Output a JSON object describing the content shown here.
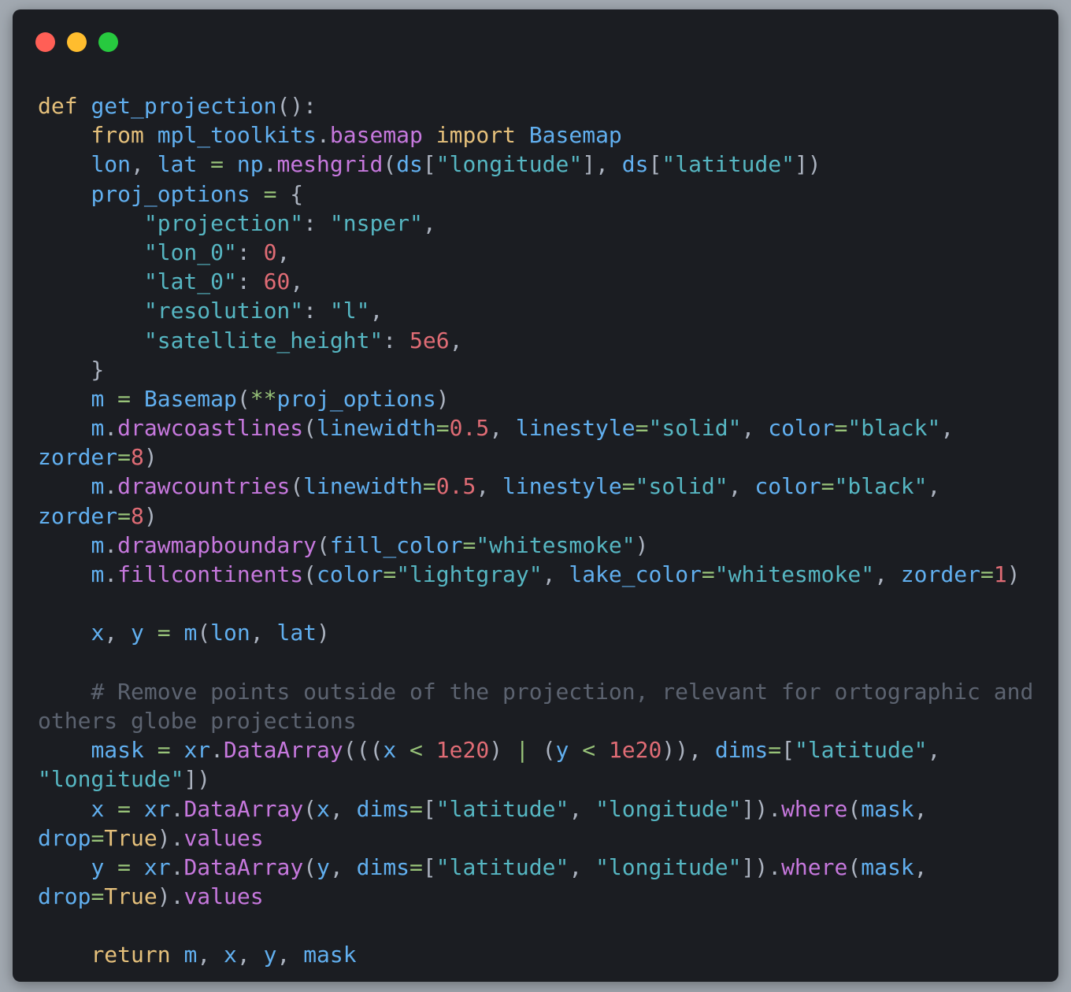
{
  "window": {
    "controls": [
      {
        "name": "close",
        "color": "#ff5f56"
      },
      {
        "name": "minimize",
        "color": "#ffbd2e"
      },
      {
        "name": "zoom",
        "color": "#27c93f"
      }
    ],
    "background": "#1b1d22"
  },
  "theme": {
    "keyword": "#e5c07b",
    "identifier": "#61afef",
    "function": "#c678dd",
    "string": "#56b6c2",
    "number": "#e06c75",
    "operator": "#98c379",
    "punctuation": "#abb2bf",
    "comment": "#5c6370"
  },
  "code": {
    "lines": [
      [
        [
          "kw",
          "def"
        ],
        [
          "pl",
          " "
        ],
        [
          "id",
          "get_projection"
        ],
        [
          "pl",
          "():"
        ]
      ],
      [
        [
          "pl",
          "    "
        ],
        [
          "kw",
          "from"
        ],
        [
          "pl",
          " "
        ],
        [
          "id",
          "mpl_toolkits"
        ],
        [
          "pl",
          "."
        ],
        [
          "fn",
          "basemap"
        ],
        [
          "pl",
          " "
        ],
        [
          "kw",
          "import"
        ],
        [
          "pl",
          " "
        ],
        [
          "id",
          "Basemap"
        ]
      ],
      [
        [
          "pl",
          "    "
        ],
        [
          "id",
          "lon"
        ],
        [
          "pl",
          ", "
        ],
        [
          "id",
          "lat"
        ],
        [
          "pl",
          " "
        ],
        [
          "op",
          "="
        ],
        [
          "pl",
          " "
        ],
        [
          "id",
          "np"
        ],
        [
          "pl",
          "."
        ],
        [
          "fn",
          "meshgrid"
        ],
        [
          "pl",
          "("
        ],
        [
          "id",
          "ds"
        ],
        [
          "pl",
          "["
        ],
        [
          "str",
          "\"longitude\""
        ],
        [
          "pl",
          "], "
        ],
        [
          "id",
          "ds"
        ],
        [
          "pl",
          "["
        ],
        [
          "str",
          "\"latitude\""
        ],
        [
          "pl",
          "])"
        ]
      ],
      [
        [
          "pl",
          "    "
        ],
        [
          "id",
          "proj_options"
        ],
        [
          "pl",
          " "
        ],
        [
          "op",
          "="
        ],
        [
          "pl",
          " {"
        ]
      ],
      [
        [
          "pl",
          "        "
        ],
        [
          "str",
          "\"projection\""
        ],
        [
          "pl",
          ": "
        ],
        [
          "str",
          "\"nsper\""
        ],
        [
          "pl",
          ","
        ]
      ],
      [
        [
          "pl",
          "        "
        ],
        [
          "str",
          "\"lon_0\""
        ],
        [
          "pl",
          ": "
        ],
        [
          "num",
          "0"
        ],
        [
          "pl",
          ","
        ]
      ],
      [
        [
          "pl",
          "        "
        ],
        [
          "str",
          "\"lat_0\""
        ],
        [
          "pl",
          ": "
        ],
        [
          "num",
          "60"
        ],
        [
          "pl",
          ","
        ]
      ],
      [
        [
          "pl",
          "        "
        ],
        [
          "str",
          "\"resolution\""
        ],
        [
          "pl",
          ": "
        ],
        [
          "str",
          "\"l\""
        ],
        [
          "pl",
          ","
        ]
      ],
      [
        [
          "pl",
          "        "
        ],
        [
          "str",
          "\"satellite_height\""
        ],
        [
          "pl",
          ": "
        ],
        [
          "num",
          "5e6"
        ],
        [
          "pl",
          ","
        ]
      ],
      [
        [
          "pl",
          "    }"
        ]
      ],
      [
        [
          "pl",
          "    "
        ],
        [
          "id",
          "m"
        ],
        [
          "pl",
          " "
        ],
        [
          "op",
          "="
        ],
        [
          "pl",
          " "
        ],
        [
          "id",
          "Basemap"
        ],
        [
          "pl",
          "("
        ],
        [
          "op",
          "**"
        ],
        [
          "id",
          "proj_options"
        ],
        [
          "pl",
          ")"
        ]
      ],
      [
        [
          "pl",
          "    "
        ],
        [
          "id",
          "m"
        ],
        [
          "pl",
          "."
        ],
        [
          "fn",
          "drawcoastlines"
        ],
        [
          "pl",
          "("
        ],
        [
          "id",
          "linewidth"
        ],
        [
          "op",
          "="
        ],
        [
          "num",
          "0.5"
        ],
        [
          "pl",
          ", "
        ],
        [
          "id",
          "linestyle"
        ],
        [
          "op",
          "="
        ],
        [
          "str",
          "\"solid\""
        ],
        [
          "pl",
          ", "
        ],
        [
          "id",
          "color"
        ],
        [
          "op",
          "="
        ],
        [
          "str",
          "\"black\""
        ],
        [
          "pl",
          ","
        ]
      ],
      [
        [
          "id",
          "zorder"
        ],
        [
          "op",
          "="
        ],
        [
          "num",
          "8"
        ],
        [
          "pl",
          ")"
        ]
      ],
      [
        [
          "pl",
          "    "
        ],
        [
          "id",
          "m"
        ],
        [
          "pl",
          "."
        ],
        [
          "fn",
          "drawcountries"
        ],
        [
          "pl",
          "("
        ],
        [
          "id",
          "linewidth"
        ],
        [
          "op",
          "="
        ],
        [
          "num",
          "0.5"
        ],
        [
          "pl",
          ", "
        ],
        [
          "id",
          "linestyle"
        ],
        [
          "op",
          "="
        ],
        [
          "str",
          "\"solid\""
        ],
        [
          "pl",
          ", "
        ],
        [
          "id",
          "color"
        ],
        [
          "op",
          "="
        ],
        [
          "str",
          "\"black\""
        ],
        [
          "pl",
          ","
        ]
      ],
      [
        [
          "id",
          "zorder"
        ],
        [
          "op",
          "="
        ],
        [
          "num",
          "8"
        ],
        [
          "pl",
          ")"
        ]
      ],
      [
        [
          "pl",
          "    "
        ],
        [
          "id",
          "m"
        ],
        [
          "pl",
          "."
        ],
        [
          "fn",
          "drawmapboundary"
        ],
        [
          "pl",
          "("
        ],
        [
          "id",
          "fill_color"
        ],
        [
          "op",
          "="
        ],
        [
          "str",
          "\"whitesmoke\""
        ],
        [
          "pl",
          ")"
        ]
      ],
      [
        [
          "pl",
          "    "
        ],
        [
          "id",
          "m"
        ],
        [
          "pl",
          "."
        ],
        [
          "fn",
          "fillcontinents"
        ],
        [
          "pl",
          "("
        ],
        [
          "id",
          "color"
        ],
        [
          "op",
          "="
        ],
        [
          "str",
          "\"lightgray\""
        ],
        [
          "pl",
          ", "
        ],
        [
          "id",
          "lake_color"
        ],
        [
          "op",
          "="
        ],
        [
          "str",
          "\"whitesmoke\""
        ],
        [
          "pl",
          ", "
        ],
        [
          "id",
          "zorder"
        ],
        [
          "op",
          "="
        ],
        [
          "num",
          "1"
        ],
        [
          "pl",
          ")"
        ]
      ],
      [],
      [
        [
          "pl",
          "    "
        ],
        [
          "id",
          "x"
        ],
        [
          "pl",
          ", "
        ],
        [
          "id",
          "y"
        ],
        [
          "pl",
          " "
        ],
        [
          "op",
          "="
        ],
        [
          "pl",
          " "
        ],
        [
          "id",
          "m"
        ],
        [
          "pl",
          "("
        ],
        [
          "id",
          "lon"
        ],
        [
          "pl",
          ", "
        ],
        [
          "id",
          "lat"
        ],
        [
          "pl",
          ")"
        ]
      ],
      [],
      [
        [
          "pl",
          "    "
        ],
        [
          "cm",
          "# Remove points outside of the projection, relevant for ortographic and"
        ]
      ],
      [
        [
          "cm",
          "others globe projections"
        ]
      ],
      [
        [
          "pl",
          "    "
        ],
        [
          "id",
          "mask"
        ],
        [
          "pl",
          " "
        ],
        [
          "op",
          "="
        ],
        [
          "pl",
          " "
        ],
        [
          "id",
          "xr"
        ],
        [
          "pl",
          "."
        ],
        [
          "fn",
          "DataArray"
        ],
        [
          "pl",
          "((("
        ],
        [
          "id",
          "x"
        ],
        [
          "pl",
          " "
        ],
        [
          "op",
          "<"
        ],
        [
          "pl",
          " "
        ],
        [
          "num",
          "1e20"
        ],
        [
          "pl",
          ") "
        ],
        [
          "op",
          "|"
        ],
        [
          "pl",
          " ("
        ],
        [
          "id",
          "y"
        ],
        [
          "pl",
          " "
        ],
        [
          "op",
          "<"
        ],
        [
          "pl",
          " "
        ],
        [
          "num",
          "1e20"
        ],
        [
          "pl",
          ")), "
        ],
        [
          "id",
          "dims"
        ],
        [
          "op",
          "="
        ],
        [
          "pl",
          "["
        ],
        [
          "str",
          "\"latitude\""
        ],
        [
          "pl",
          ","
        ]
      ],
      [
        [
          "str",
          "\"longitude\""
        ],
        [
          "pl",
          "])"
        ]
      ],
      [
        [
          "pl",
          "    "
        ],
        [
          "id",
          "x"
        ],
        [
          "pl",
          " "
        ],
        [
          "op",
          "="
        ],
        [
          "pl",
          " "
        ],
        [
          "id",
          "xr"
        ],
        [
          "pl",
          "."
        ],
        [
          "fn",
          "DataArray"
        ],
        [
          "pl",
          "("
        ],
        [
          "id",
          "x"
        ],
        [
          "pl",
          ", "
        ],
        [
          "id",
          "dims"
        ],
        [
          "op",
          "="
        ],
        [
          "pl",
          "["
        ],
        [
          "str",
          "\"latitude\""
        ],
        [
          "pl",
          ", "
        ],
        [
          "str",
          "\"longitude\""
        ],
        [
          "pl",
          "])."
        ],
        [
          "fn",
          "where"
        ],
        [
          "pl",
          "("
        ],
        [
          "id",
          "mask"
        ],
        [
          "pl",
          ","
        ]
      ],
      [
        [
          "id",
          "drop"
        ],
        [
          "op",
          "="
        ],
        [
          "kw",
          "True"
        ],
        [
          "pl",
          ")."
        ],
        [
          "fn",
          "values"
        ]
      ],
      [
        [
          "pl",
          "    "
        ],
        [
          "id",
          "y"
        ],
        [
          "pl",
          " "
        ],
        [
          "op",
          "="
        ],
        [
          "pl",
          " "
        ],
        [
          "id",
          "xr"
        ],
        [
          "pl",
          "."
        ],
        [
          "fn",
          "DataArray"
        ],
        [
          "pl",
          "("
        ],
        [
          "id",
          "y"
        ],
        [
          "pl",
          ", "
        ],
        [
          "id",
          "dims"
        ],
        [
          "op",
          "="
        ],
        [
          "pl",
          "["
        ],
        [
          "str",
          "\"latitude\""
        ],
        [
          "pl",
          ", "
        ],
        [
          "str",
          "\"longitude\""
        ],
        [
          "pl",
          "])."
        ],
        [
          "fn",
          "where"
        ],
        [
          "pl",
          "("
        ],
        [
          "id",
          "mask"
        ],
        [
          "pl",
          ","
        ]
      ],
      [
        [
          "id",
          "drop"
        ],
        [
          "op",
          "="
        ],
        [
          "kw",
          "True"
        ],
        [
          "pl",
          ")."
        ],
        [
          "fn",
          "values"
        ]
      ],
      [],
      [
        [
          "pl",
          "    "
        ],
        [
          "kw",
          "return"
        ],
        [
          "pl",
          " "
        ],
        [
          "id",
          "m"
        ],
        [
          "pl",
          ", "
        ],
        [
          "id",
          "x"
        ],
        [
          "pl",
          ", "
        ],
        [
          "id",
          "y"
        ],
        [
          "pl",
          ", "
        ],
        [
          "id",
          "mask"
        ]
      ]
    ]
  }
}
